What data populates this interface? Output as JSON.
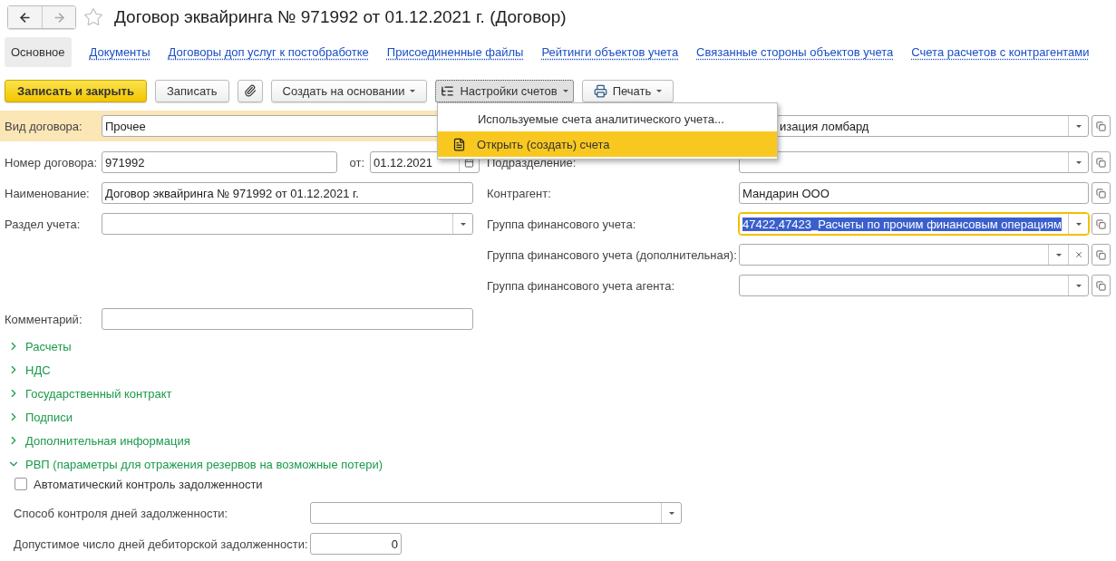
{
  "window": {
    "title": "Договор эквайринга № 971992 от 01.12.2021 г. (Договор)",
    "back_enabled": true,
    "forward_enabled": false
  },
  "tabs": [
    {
      "label": "Основное",
      "selected": true
    },
    {
      "label": "Документы",
      "selected": false
    },
    {
      "label": "Договоры доп услуг к постобработке",
      "selected": false
    },
    {
      "label": "Присоединенные файлы",
      "selected": false
    },
    {
      "label": "Рейтинги объектов учета",
      "selected": false
    },
    {
      "label": "Связанные стороны объектов учета",
      "selected": false
    },
    {
      "label": "Счета расчетов с контрагентами",
      "selected": false
    }
  ],
  "toolbar": [
    {
      "kind": "primary",
      "label": "Записать и закрыть",
      "pressed": false
    },
    {
      "kind": "plain",
      "label": "Записать",
      "pressed": false
    },
    {
      "kind": "attach",
      "pressed": false
    },
    {
      "kind": "dropdown",
      "label": "Создать на основании",
      "pressed": false
    },
    {
      "kind": "accounts",
      "label": "Настройки счетов",
      "pressed": true
    },
    {
      "kind": "print",
      "label": "Печать",
      "pressed": false
    }
  ],
  "menu": {
    "items": [
      {
        "label": "Используемые счета аналитического учета...",
        "icon": false,
        "selected": false
      },
      {
        "label": "Открыть (создать) счета",
        "icon": true,
        "selected": true
      }
    ]
  },
  "left_fields": [
    {
      "kind": "text",
      "label": "Вид договора:",
      "value": "Прочее",
      "highlighted": true
    },
    {
      "kind": "number_date",
      "label": "Номер договора:",
      "value": "971992",
      "date_label": "от:",
      "date_value": "01.12.2021",
      "highlighted": false
    },
    {
      "kind": "text",
      "label": "Наименование:",
      "value": "Договор эквайринга № 971992 от 01.12.2021 г.",
      "highlighted": false
    },
    {
      "kind": "combo",
      "label": "Раздел учета:",
      "highlighted": false
    }
  ],
  "right_fields": [
    {
      "kind": "combo_open",
      "value": "изация ломбард",
      "covered": true,
      "focused": false
    },
    {
      "kind": "combo_open",
      "label": "Подразделение:",
      "focused": false
    },
    {
      "kind": "open",
      "label": "Контрагент:",
      "value": "Мандарин ООО",
      "focused": false
    },
    {
      "kind": "combo_open",
      "label": "Группа финансового учета:",
      "value": "47422,47423_Расчеты по прочим финансовым операциям",
      "focused": true
    },
    {
      "kind": "combo_clear_open",
      "label": "Группа финансового учета (дополнительная):",
      "focused": false
    },
    {
      "kind": "combo_open",
      "label": "Группа финансового учета агента:",
      "focused": false
    }
  ],
  "comment": {
    "label": "Комментарий:"
  },
  "groups": [
    {
      "label": "Расчеты",
      "expanded": false
    },
    {
      "label": "НДС",
      "expanded": false
    },
    {
      "label": "Государственный контракт",
      "expanded": false
    },
    {
      "label": "Подписи",
      "expanded": false
    },
    {
      "label": "Дополнительная информация",
      "expanded": false
    },
    {
      "label": "РВП (параметры для отражения резервов на возможные потери)",
      "expanded": true
    }
  ],
  "rvp": {
    "checkbox": {
      "label": "Автоматический контроль задолженности",
      "checked": false
    },
    "fields": [
      {
        "kind": "combo",
        "label": "Способ контроля дней задолженности:"
      },
      {
        "kind": "number",
        "label": "Допустимое число дней дебиторской задолженности:",
        "value": "0"
      }
    ]
  }
}
